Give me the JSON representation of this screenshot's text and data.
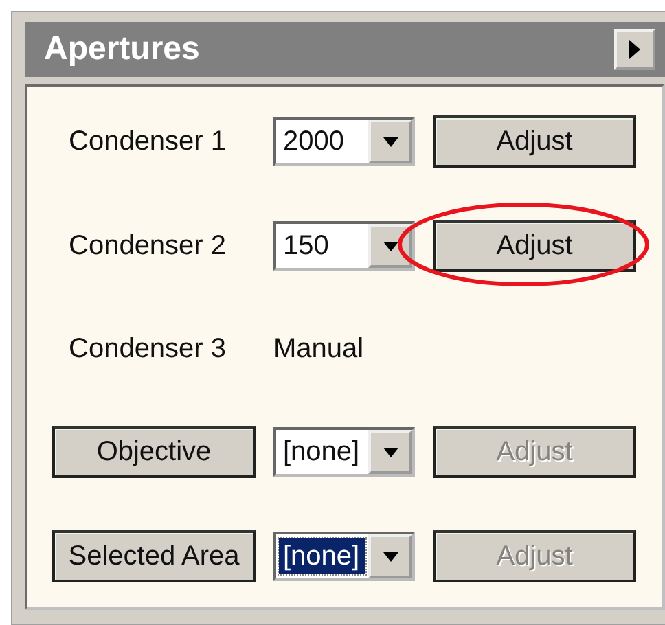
{
  "panel": {
    "title": "Apertures"
  },
  "rows": [
    {
      "kind": "combo",
      "label": "Condenser 1",
      "value": "2000",
      "focused": false,
      "adjust": {
        "label": "Adjust",
        "disabled": false,
        "circled": false
      }
    },
    {
      "kind": "combo",
      "label": "Condenser 2",
      "value": "150",
      "focused": false,
      "adjust": {
        "label": "Adjust",
        "disabled": false,
        "circled": true
      }
    },
    {
      "kind": "text",
      "label": "Condenser 3",
      "value": "Manual"
    },
    {
      "kind": "button",
      "label": "Objective",
      "value": "[none]",
      "focused": false,
      "adjust": {
        "label": "Adjust",
        "disabled": true,
        "circled": false
      }
    },
    {
      "kind": "button",
      "label": "Selected Area",
      "value": "[none]",
      "focused": true,
      "adjust": {
        "label": "Adjust",
        "disabled": true,
        "circled": false
      }
    }
  ]
}
